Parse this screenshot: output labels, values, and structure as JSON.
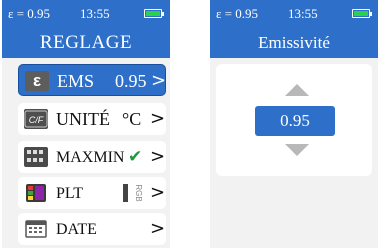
{
  "left_screen": {
    "status": {
      "epsilon": "ε = 0.95",
      "time": "13:55"
    },
    "title": "REGLAGE",
    "menu": {
      "ems": {
        "icon": "ε",
        "label": "EMS",
        "value": "0.95",
        "chevron": ">"
      },
      "unite": {
        "label": "UNITÉ",
        "value": "°C",
        "chevron": ">"
      },
      "maxmin": {
        "label": "MAXMIN",
        "check": "✔",
        "chevron": ">"
      },
      "plt": {
        "label": "PLT",
        "icon_text": "RGB",
        "chevron": ">"
      },
      "date": {
        "label": "DATE",
        "chevron": ">"
      }
    }
  },
  "right_screen": {
    "status": {
      "epsilon": "ε = 0.95",
      "time": "13:55"
    },
    "title": "Emissivité",
    "value": "0.95"
  },
  "colors": {
    "accent": "#2e70c9",
    "background": "#f2f2f2",
    "battery": "#2bd14a",
    "check": "#1e9a3a",
    "arrow": "#b8b8b8"
  },
  "icons": [
    "battery-icon",
    "epsilon-icon",
    "cf-icon",
    "maxmin-icon",
    "palette-icon",
    "calendar-icon",
    "check-icon",
    "chevron-right-icon",
    "arrow-up-icon",
    "arrow-down-icon"
  ]
}
